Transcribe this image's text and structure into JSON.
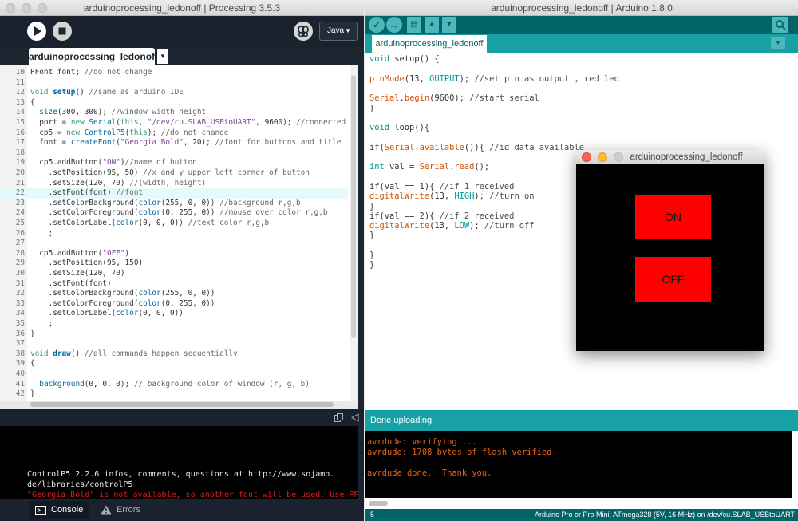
{
  "processing": {
    "window_title": "arduinoprocessing_ledonoff | Processing 3.5.3",
    "mode": "Java",
    "tab_label": "arduinoprocessing_ledonoff",
    "lines": [
      {
        "n": "10",
        "t": "PFont font; //do not change"
      },
      {
        "n": "11",
        "t": ""
      },
      {
        "n": "12",
        "t": "void setup() //same as arduino IDE"
      },
      {
        "n": "13",
        "t": "{"
      },
      {
        "n": "14",
        "t": "  size(300, 300); //window width height"
      },
      {
        "n": "15",
        "t": "  port = new Serial(this, \"/dev/cu.SLAB_USBtoUART\", 9600); //connected a"
      },
      {
        "n": "16",
        "t": "  cp5 = new ControlP5(this); //do not change"
      },
      {
        "n": "17",
        "t": "  font = createFont(\"Georgia Bold\", 20); //font for buttons and title"
      },
      {
        "n": "18",
        "t": ""
      },
      {
        "n": "19",
        "t": "  cp5.addButton(\"ON\")//name of button"
      },
      {
        "n": "20",
        "t": "    .setPosition(95, 50) //x and y upper left corner of button"
      },
      {
        "n": "21",
        "t": "    .setSize(120, 70) //(width, height)"
      },
      {
        "n": "22",
        "t": "    .setFont(font) //font"
      },
      {
        "n": "23",
        "t": "    .setColorBackground(color(255, 0, 0)) //background r,g,b"
      },
      {
        "n": "24",
        "t": "    .setColorForeground(color(0, 255, 0)) //mouse over color r,g,b"
      },
      {
        "n": "25",
        "t": "    .setColorLabel(color(0, 0, 0)) //text color r,g,b"
      },
      {
        "n": "26",
        "t": "    ;"
      },
      {
        "n": "27",
        "t": ""
      },
      {
        "n": "28",
        "t": "  cp5.addButton(\"OFF\")"
      },
      {
        "n": "29",
        "t": "    .setPosition(95, 150)"
      },
      {
        "n": "30",
        "t": "    .setSize(120, 70)"
      },
      {
        "n": "31",
        "t": "    .setFont(font)"
      },
      {
        "n": "32",
        "t": "    .setColorBackground(color(255, 0, 0))"
      },
      {
        "n": "33",
        "t": "    .setColorForeground(color(0, 255, 0))"
      },
      {
        "n": "34",
        "t": "    .setColorLabel(color(0, 0, 0))"
      },
      {
        "n": "35",
        "t": "    ;"
      },
      {
        "n": "36",
        "t": "}"
      },
      {
        "n": "37",
        "t": ""
      },
      {
        "n": "38",
        "t": "void draw() //all commands happen sequentially"
      },
      {
        "n": "39",
        "t": "{"
      },
      {
        "n": "40",
        "t": ""
      },
      {
        "n": "41",
        "t": "  background(0, 0, 0); // background color of window (r, g, b)"
      },
      {
        "n": "42",
        "t": "}"
      }
    ],
    "highlighted_line": "22",
    "console_lines": [
      "ControlP5 2.2.6 infos, comments, questions at http://www.sojamo.",
      "de/libraries/controlP5"
    ],
    "console_error": "\"Georgia Bold\" is not available, so another font will be used. Use PFont.",
    "console_tab": "Console",
    "errors_tab": "Errors"
  },
  "arduino": {
    "window_title": "arduinoprocessing_ledonoff | Arduino 1.8.0",
    "tab_label": "arduinoprocessing_ledonoff",
    "lines": [
      "void setup() {",
      "",
      "pinMode(13, OUTPUT); //set pin as output , red led",
      "",
      "Serial.begin(9600); //start serial",
      "}",
      "",
      "void loop(){",
      "",
      "if(Serial.available()){ //id data available",
      "",
      "int val = Serial.read();",
      "",
      "if(val == 1){ //if 1 received",
      "digitalWrite(13, HIGH); //turn on",
      "}",
      "if(val == 2){ //if 2 received",
      "digitalWrite(13, LOW); //turn off",
      "}",
      "",
      "}",
      "}"
    ],
    "status": "Done uploading.",
    "output": [
      "avrdude: verifying ...",
      "avrdude: 1708 bytes of flash verified",
      "",
      "avrdude done.  Thank you."
    ],
    "footer_line": "5",
    "footer_board": "Arduino Pro or Pro Mini, ATmega328 (5V, 16 MHz) on /dev/cu.SLAB_USBtoUART"
  },
  "sketch": {
    "window_title": "arduinoprocessing_ledonoff",
    "on_label": "ON",
    "off_label": "OFF",
    "button_color": "#ff0000"
  },
  "icons": {
    "run": "play-icon",
    "stop": "stop-icon",
    "debug": "butterfly-icon",
    "verify": "check-icon",
    "upload": "arrow-right-icon",
    "new": "new-file-icon",
    "open": "arrow-up-icon",
    "save": "arrow-down-icon",
    "monitor": "magnifier-icon"
  }
}
